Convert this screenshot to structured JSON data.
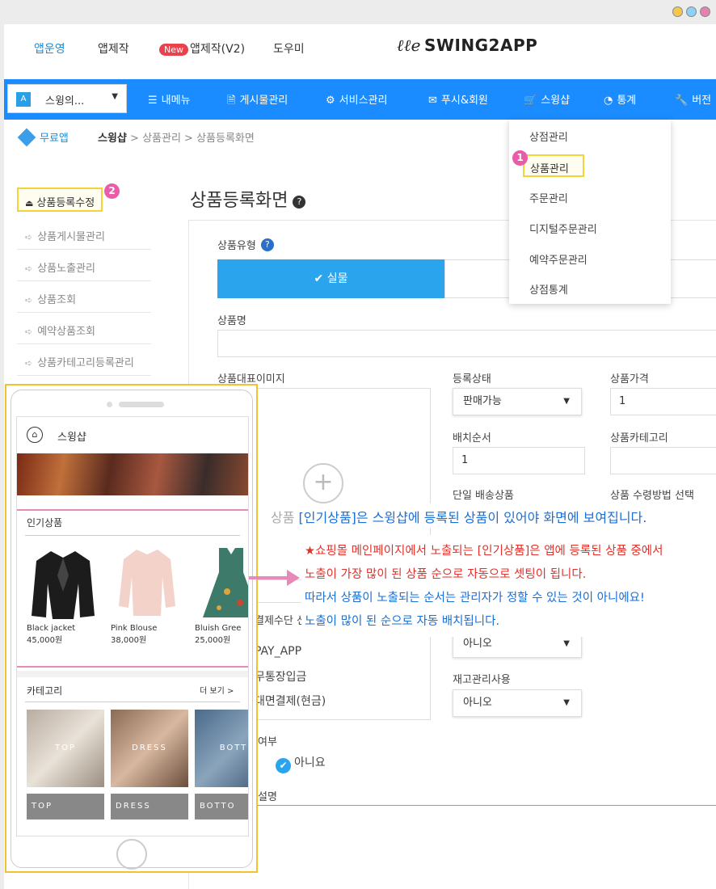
{
  "top_nav": {
    "items": [
      "앱운영",
      "앱제작",
      "앱제작(V2)",
      "도우미"
    ],
    "new_badge": "New",
    "logo": "SWING2APP",
    "logo_script": "ℓℓe"
  },
  "menu_bar": {
    "app_selector": "스윙의...",
    "app_selector_icon": "A",
    "items": [
      "내메뉴",
      "게시물관리",
      "서비스관리",
      "푸시&회원",
      "스윙샵",
      "통계",
      "버전"
    ]
  },
  "breadcrumb": {
    "free_app": "무료앱",
    "free_icon": "F",
    "path": [
      "스윙샵",
      "상품관리",
      "상품등록화면"
    ]
  },
  "dropdown": {
    "items": [
      "상점관리",
      "상품관리",
      "주문관리",
      "디지털주문관리",
      "예약주문관리",
      "상점통계"
    ],
    "badge": "1"
  },
  "sidebar": {
    "active": "상품등록수정",
    "badge": "2",
    "items": [
      "상품게시물관리",
      "상품노출관리",
      "상품조회",
      "예약상품조회",
      "상품카테고리등록관리"
    ]
  },
  "page_title": "상품등록화면",
  "form": {
    "product_type_label": "상품유형",
    "product_type_selected": "실물",
    "product_name_label": "상품명",
    "image_label": "상품대표이미지",
    "status_label": "등록상태",
    "status_value": "판매가능",
    "price_label": "상품가격",
    "price_value": "1",
    "order_label": "배치순서",
    "order_value": "1",
    "category_label": "상품카테고리",
    "single_ship_label": "단일 배송상품",
    "receive_label": "상품 수령방법 선택",
    "payment_label_partial": "결제수단 선",
    "payment_items": [
      "PAY_APP",
      "무통장입금",
      "대면결제(현금)"
    ],
    "select_no_1": "아니오",
    "stock_label": "재고관리사용",
    "select_no_2": "아니오",
    "yesno_label_partial": "여부",
    "radio_value": "아니요",
    "desc_label_partial": "설명",
    "image_label_partial": "상품"
  },
  "phone": {
    "shop_name": "스윙샵",
    "popular_title": "인기상품",
    "products": [
      {
        "name": "Black jacket",
        "price": "45,000원"
      },
      {
        "name": "Pink Blouse",
        "price": "38,000원"
      },
      {
        "name": "Bluish Gree",
        "price": "25,000원"
      }
    ],
    "category_title": "카테고리",
    "more": "더 보기 >",
    "categories": [
      {
        "overlay": "TOP",
        "label": "TOP"
      },
      {
        "overlay": "DRESS",
        "label": "DRESS"
      },
      {
        "overlay": "BOTT",
        "label": "BOTTO"
      }
    ]
  },
  "callout": {
    "line1": "[인기상품]은 스윙샵에 등록된 상품이 있어야 화면에 보여집니다.",
    "line2": "★쇼핑몰 메인페이지에서 노출되는 [인기상품]은 앱에 등록된 상품 중에서",
    "line3": "노출이 가장 많이 된 상품 순으로 자동으로 셋팅이 됩니다.",
    "line4": "따라서 상품이 노출되는 순서는 관리자가 정할 수 있는 것이 아니에요!",
    "line5": "노출이 많이 된 순으로 자동 배치됩니다."
  },
  "colors": {
    "accent": "#1a8cff",
    "highlight": "#f2d33a",
    "pink": "#e88ab8",
    "red": "#e4302a"
  },
  "icons": [
    "hamburger-icon",
    "document-icon",
    "gear-icon",
    "mail-icon",
    "cart-icon",
    "pie-chart-icon",
    "wrench-icon",
    "home-icon",
    "plus-icon",
    "check-icon"
  ]
}
